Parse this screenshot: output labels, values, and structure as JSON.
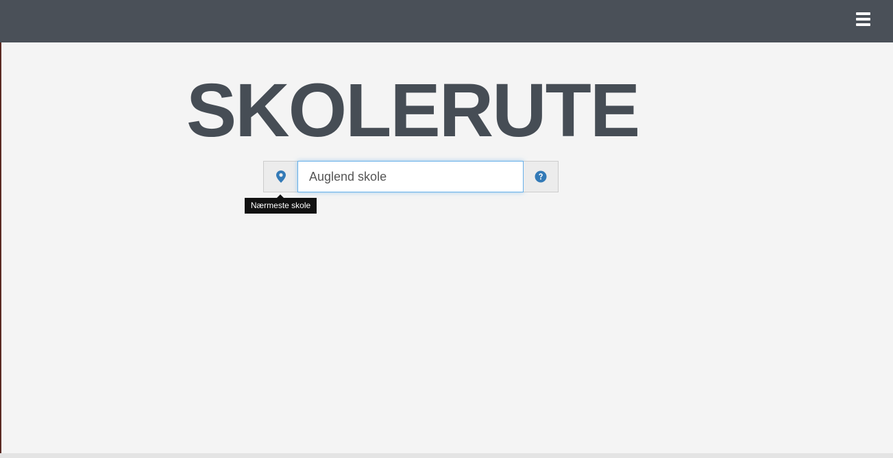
{
  "app": {
    "title": "SKOLERUTE"
  },
  "header": {
    "menu_icon": "hamburger-menu-icon"
  },
  "search": {
    "value": "Auglend skole",
    "left_icon": "map-marker-icon",
    "right_icon": "question-circle-icon"
  },
  "tooltip": {
    "text": "Nærmeste skole"
  },
  "colors": {
    "topbar": "#4a5058",
    "title": "#464d55",
    "icon_accent": "#337ab7",
    "background": "#f4f4f4"
  }
}
